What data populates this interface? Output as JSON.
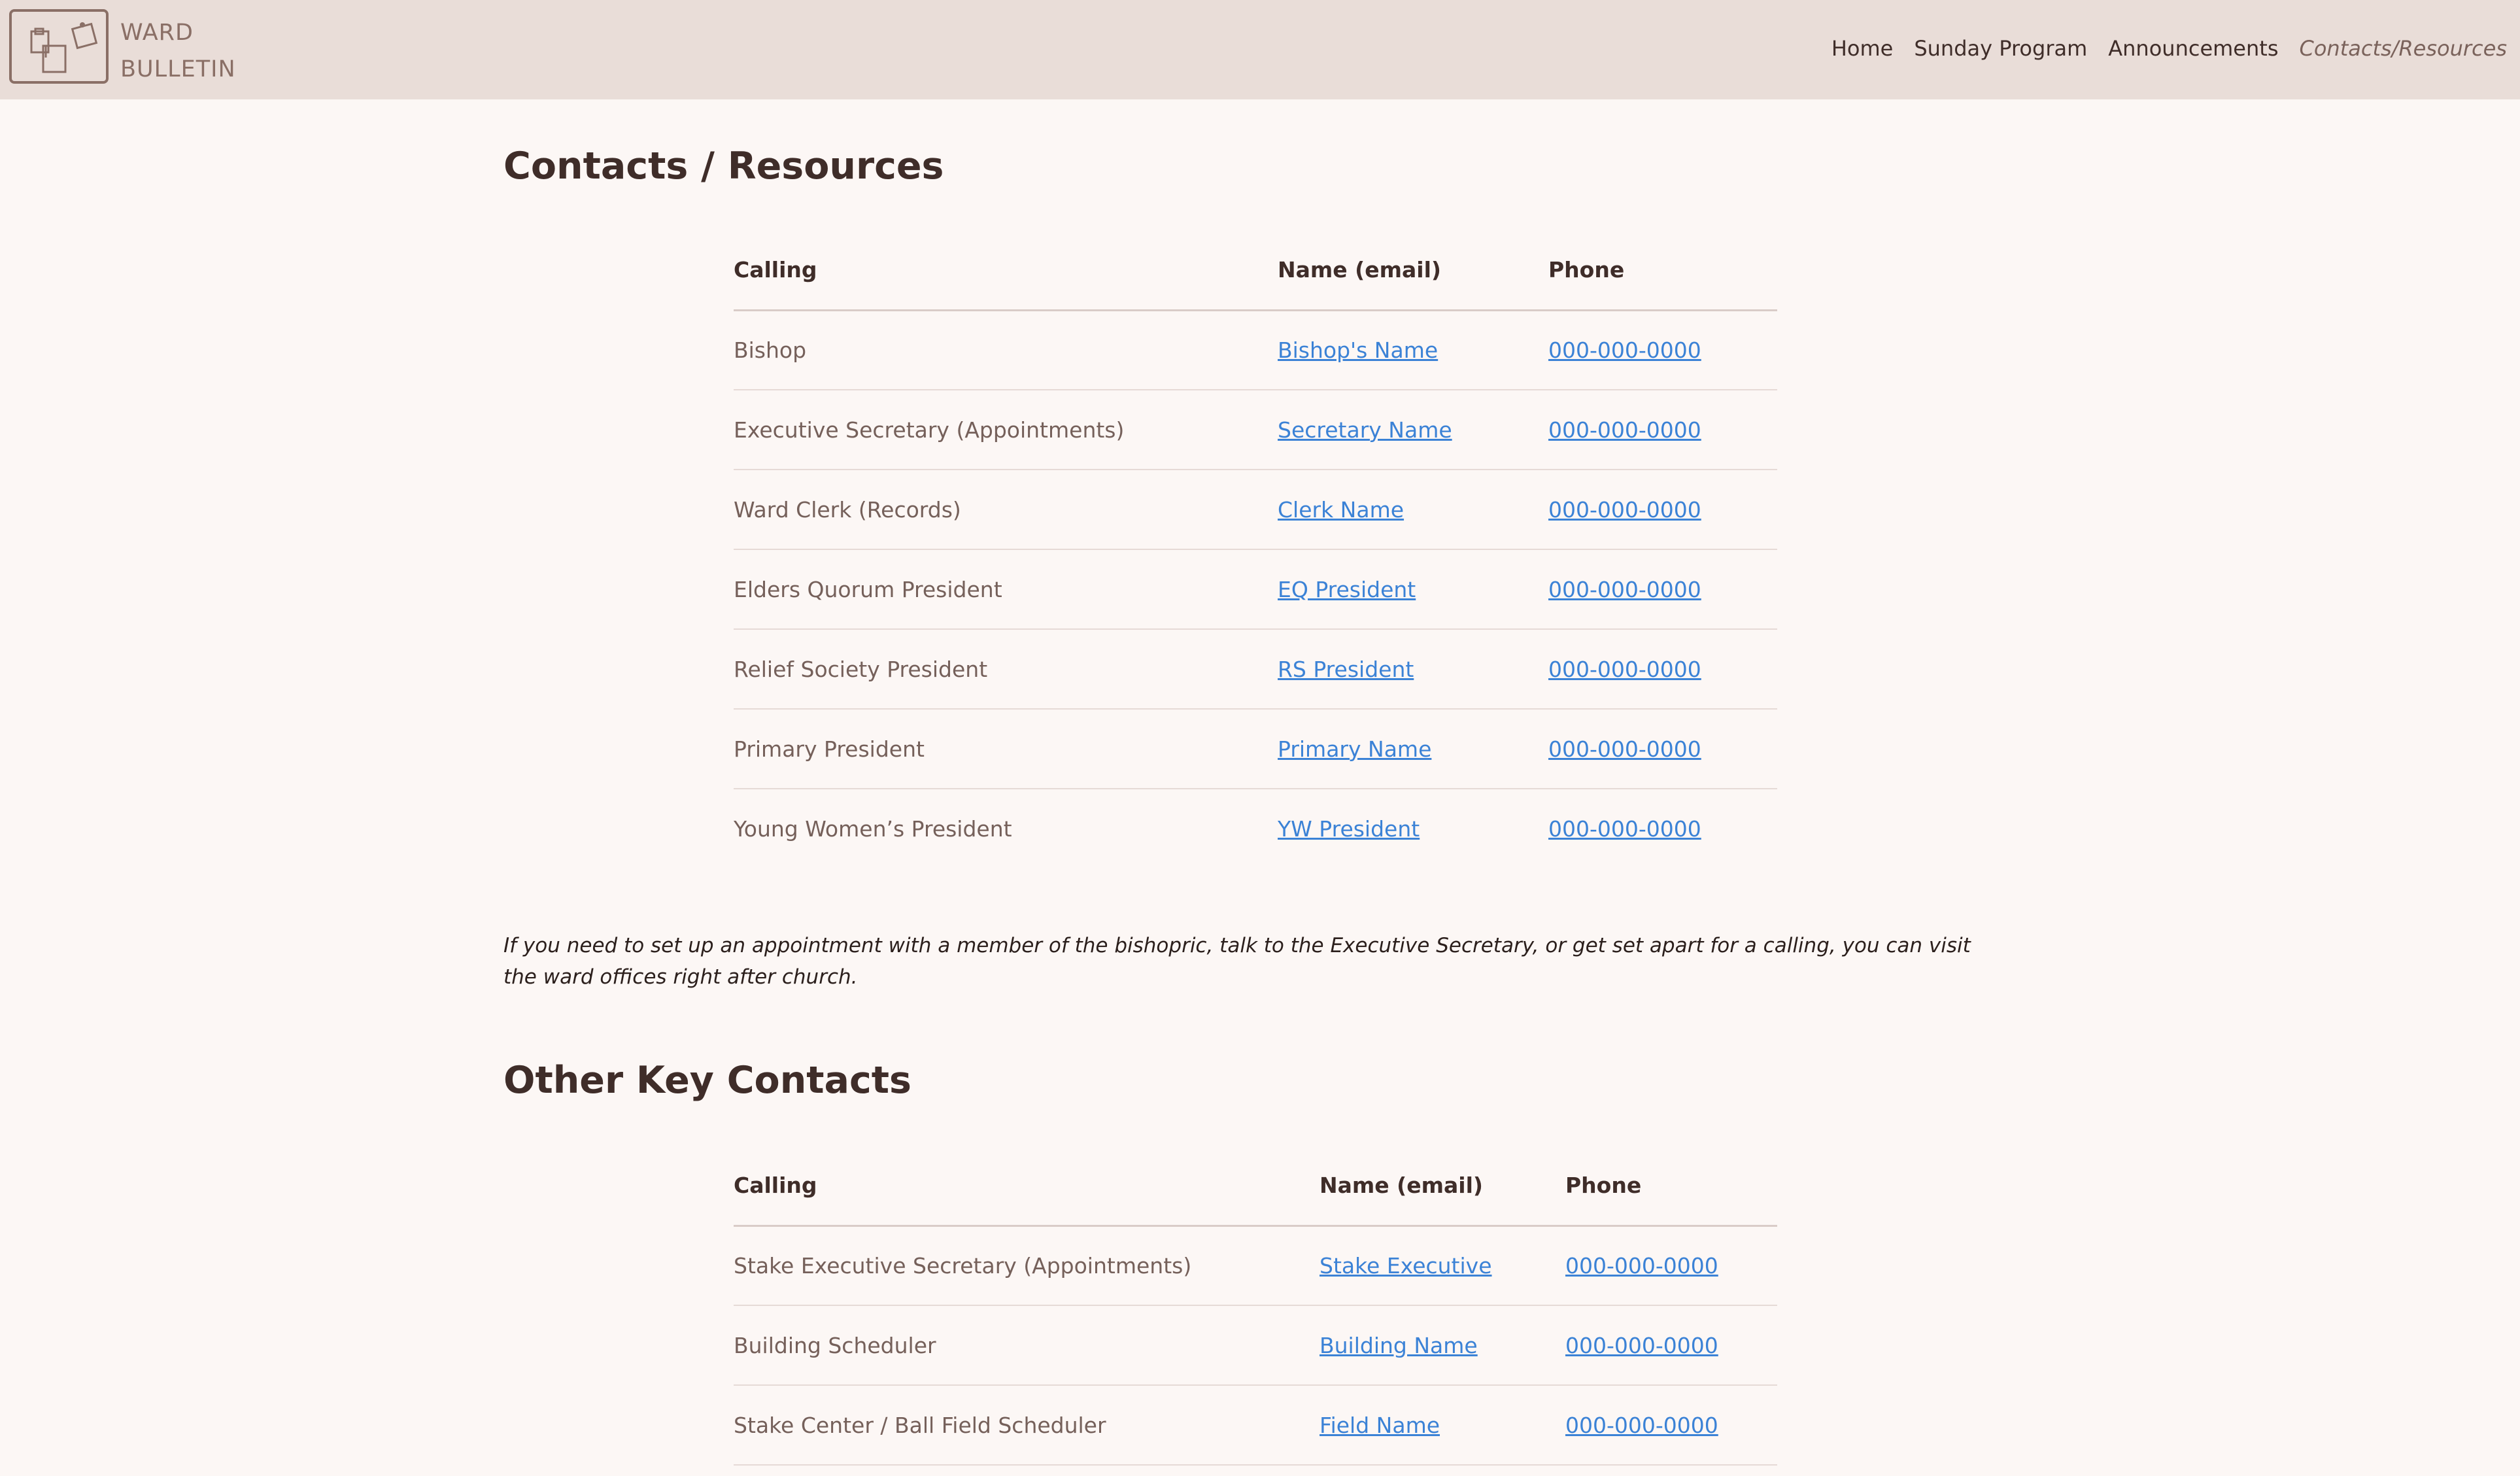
{
  "header": {
    "brand_line1": "WARD",
    "brand_line2": "BULLETIN",
    "nav": [
      {
        "label": "Home",
        "active": false
      },
      {
        "label": "Sunday Program",
        "active": false
      },
      {
        "label": "Announcements",
        "active": false
      },
      {
        "label": "Contacts/Resources",
        "active": true
      }
    ]
  },
  "contacts": {
    "title": "Contacts / Resources",
    "headers": {
      "calling": "Calling",
      "name": "Name (email)",
      "phone": "Phone"
    },
    "rows": [
      {
        "calling": "Bishop",
        "name": "Bishop's Name",
        "phone": "000-000-0000"
      },
      {
        "calling": "Executive Secretary (Appointments)",
        "name": "Secretary Name",
        "phone": "000-000-0000"
      },
      {
        "calling": "Ward Clerk (Records)",
        "name": "Clerk Name",
        "phone": "000-000-0000"
      },
      {
        "calling": "Elders Quorum President",
        "name": "EQ President",
        "phone": "000-000-0000"
      },
      {
        "calling": "Relief Society President",
        "name": "RS President",
        "phone": "000-000-0000"
      },
      {
        "calling": "Primary President",
        "name": "Primary Name",
        "phone": "000-000-0000"
      },
      {
        "calling": "Young Women’s President",
        "name": "YW President",
        "phone": "000-000-0000"
      }
    ],
    "note": "If you need to set up an appointment with a member of the bishopric, talk to the Executive Secretary, or get set apart for a calling, you can visit the ward offices right after church."
  },
  "other": {
    "title": "Other Key Contacts",
    "headers": {
      "calling": "Calling",
      "name": "Name (email)",
      "phone": "Phone"
    },
    "rows": [
      {
        "calling": "Stake Executive Secretary (Appointments)",
        "name": "Stake Executive",
        "phone": "000-000-0000"
      },
      {
        "calling": "Building Scheduler",
        "name": "Building Name",
        "phone": "000-000-0000"
      },
      {
        "calling": "Stake Center / Ball Field Scheduler",
        "name": "Field Name",
        "phone": "000-000-0000"
      }
    ]
  },
  "colors": {
    "header_bg": "#e9ddd8",
    "page_bg": "#fcf7f5",
    "link": "#3b82d6",
    "text_dark": "#3f2d29",
    "text_muted": "#75605a"
  },
  "icons": {
    "logo": "bulletin-board-icon"
  }
}
